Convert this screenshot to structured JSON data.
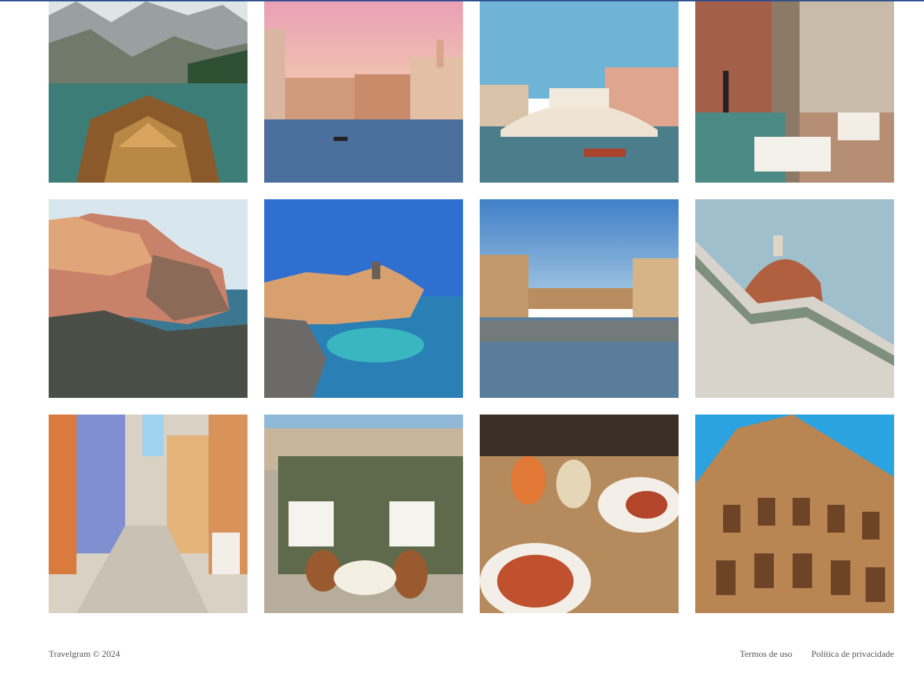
{
  "photos": [
    {
      "icon": "lake-boat-photo"
    },
    {
      "icon": "venice-canal-photo"
    },
    {
      "icon": "rialto-bridge-photo"
    },
    {
      "icon": "canal-cafe-photo"
    },
    {
      "icon": "manarola-photo"
    },
    {
      "icon": "vernazza-photo"
    },
    {
      "icon": "ponte-vecchio-photo"
    },
    {
      "icon": "florence-duomo-photo"
    },
    {
      "icon": "alley-scooter-photo"
    },
    {
      "icon": "trattoria-scooter-photo"
    },
    {
      "icon": "aperitivo-pasta-photo"
    },
    {
      "icon": "colosseum-photo"
    }
  ],
  "footer": {
    "copyright": "Travelgram © 2024",
    "links": [
      "Termos de uso",
      "Política de privacidade"
    ]
  }
}
